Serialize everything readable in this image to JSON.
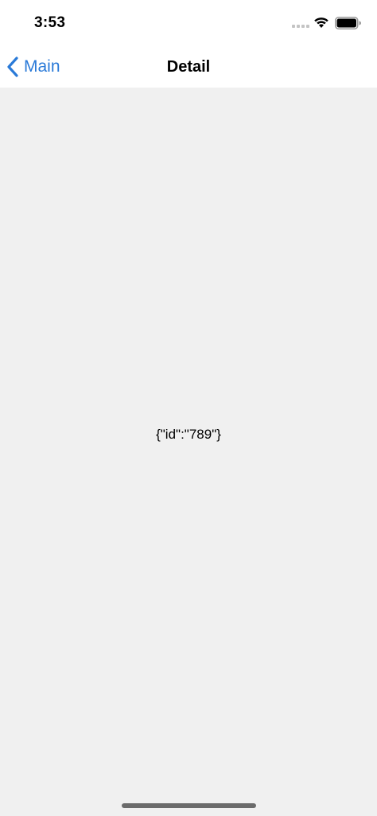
{
  "status_bar": {
    "time": "3:53",
    "icons": [
      "signal-icon",
      "wifi-icon",
      "battery-icon"
    ]
  },
  "nav": {
    "back_label": "Main",
    "back_icon": "chevron-left-icon",
    "title": "Detail"
  },
  "content": {
    "text": "{\"id\":\"789\"}"
  },
  "colors": {
    "accent": "#2a7ad8",
    "background": "#f0f0f0",
    "header": "#ffffff"
  }
}
